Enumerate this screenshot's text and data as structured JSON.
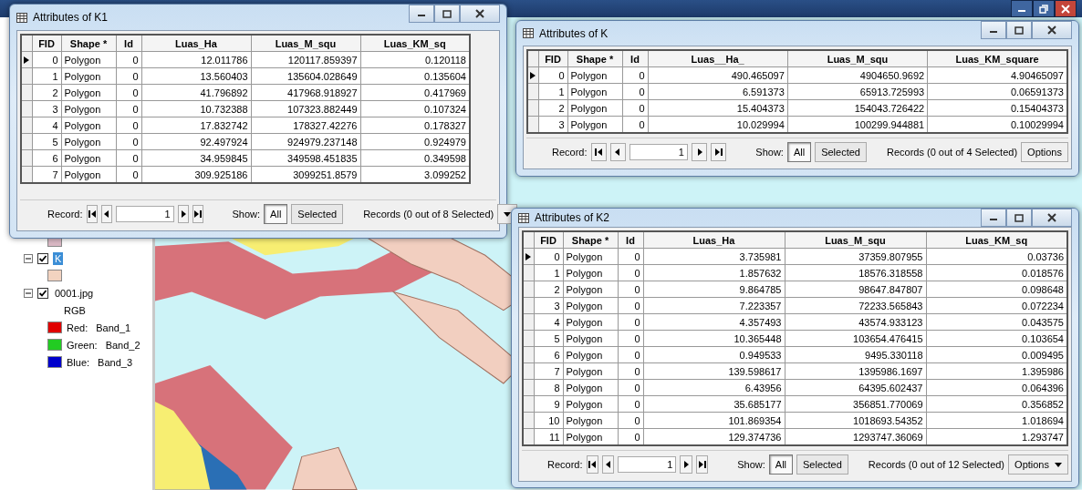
{
  "toc": {
    "items": [
      {
        "kind": "swatch",
        "color": "#d9b8c4"
      },
      {
        "kind": "layer",
        "label": "K",
        "checked": true,
        "expanded": true,
        "selected": true
      },
      {
        "kind": "swatch",
        "color": "#f2d3c0"
      },
      {
        "kind": "layer",
        "label": "0001.jpg",
        "checked": true,
        "expanded": true,
        "selected": false
      },
      {
        "kind": "heading",
        "label": "RGB"
      },
      {
        "kind": "band",
        "label": "Red:",
        "value": "Band_1",
        "color": "#e00000"
      },
      {
        "kind": "band",
        "label": "Green:",
        "value": "Band_2",
        "color": "#22cc22"
      },
      {
        "kind": "band",
        "label": "Blue:",
        "value": "Band_3",
        "color": "#0000cc"
      }
    ]
  },
  "windows": [
    {
      "title": "Attributes of K1",
      "columns": [
        "FID",
        "Shape *",
        "Id",
        "Luas_Ha",
        "Luas_M_squ",
        "Luas_KM_sq"
      ],
      "rows": [
        {
          "current": true,
          "cells": [
            "0",
            "Polygon",
            "0",
            "12.011786",
            "120117.859397",
            "0.120118"
          ]
        },
        {
          "current": false,
          "cells": [
            "1",
            "Polygon",
            "0",
            "13.560403",
            "135604.028649",
            "0.135604"
          ]
        },
        {
          "current": false,
          "cells": [
            "2",
            "Polygon",
            "0",
            "41.796892",
            "417968.918927",
            "0.417969"
          ]
        },
        {
          "current": false,
          "cells": [
            "3",
            "Polygon",
            "0",
            "10.732388",
            "107323.882449",
            "0.107324"
          ]
        },
        {
          "current": false,
          "cells": [
            "4",
            "Polygon",
            "0",
            "17.832742",
            "178327.42276",
            "0.178327"
          ]
        },
        {
          "current": false,
          "cells": [
            "5",
            "Polygon",
            "0",
            "92.497924",
            "924979.237148",
            "0.924979"
          ]
        },
        {
          "current": false,
          "cells": [
            "6",
            "Polygon",
            "0",
            "34.959845",
            "349598.451835",
            "0.349598"
          ]
        },
        {
          "current": false,
          "cells": [
            "7",
            "Polygon",
            "0",
            "309.925186",
            "3099251.8579",
            "3.099252"
          ]
        }
      ],
      "record_label": "Record:",
      "record_value": "1",
      "show_label": "Show:",
      "show": [
        {
          "label": "All",
          "selected": true
        },
        {
          "label": "Selected",
          "selected": false
        }
      ],
      "records": "Records (0 out of 8 Selected)",
      "options": {
        "caret": true
      }
    },
    {
      "title": "Attributes of K",
      "columns": [
        "FID",
        "Shape *",
        "Id",
        "Luas__Ha_",
        "Luas_M_squ",
        "Luas_KM_square"
      ],
      "rows": [
        {
          "current": true,
          "cells": [
            "0",
            "Polygon",
            "0",
            "490.465097",
            "4904650.9692",
            "4.90465097"
          ]
        },
        {
          "current": false,
          "cells": [
            "1",
            "Polygon",
            "0",
            "6.591373",
            "65913.725993",
            "0.06591373"
          ]
        },
        {
          "current": false,
          "cells": [
            "2",
            "Polygon",
            "0",
            "15.404373",
            "154043.726422",
            "0.15404373"
          ]
        },
        {
          "current": false,
          "cells": [
            "3",
            "Polygon",
            "0",
            "10.029994",
            "100299.944881",
            "0.10029994"
          ]
        }
      ],
      "record_label": "Record:",
      "record_value": "1",
      "show_label": "Show:",
      "show": [
        {
          "label": "All",
          "selected": true
        },
        {
          "label": "Selected",
          "selected": false
        }
      ],
      "records": "Records (0 out of 4 Selected)",
      "options": {
        "label": "Options",
        "caret": false
      }
    },
    {
      "title": "Attributes of K2",
      "columns": [
        "FID",
        "Shape *",
        "Id",
        "Luas_Ha",
        "Luas_M_squ",
        "Luas_KM_sq"
      ],
      "rows": [
        {
          "current": true,
          "cells": [
            "0",
            "Polygon",
            "0",
            "3.735981",
            "37359.807955",
            "0.03736"
          ]
        },
        {
          "current": false,
          "cells": [
            "1",
            "Polygon",
            "0",
            "1.857632",
            "18576.318558",
            "0.018576"
          ]
        },
        {
          "current": false,
          "cells": [
            "2",
            "Polygon",
            "0",
            "9.864785",
            "98647.847807",
            "0.098648"
          ]
        },
        {
          "current": false,
          "cells": [
            "3",
            "Polygon",
            "0",
            "7.223357",
            "72233.565843",
            "0.072234"
          ]
        },
        {
          "current": false,
          "cells": [
            "4",
            "Polygon",
            "0",
            "4.357493",
            "43574.933123",
            "0.043575"
          ]
        },
        {
          "current": false,
          "cells": [
            "5",
            "Polygon",
            "0",
            "10.365448",
            "103654.476415",
            "0.103654"
          ]
        },
        {
          "current": false,
          "cells": [
            "6",
            "Polygon",
            "0",
            "0.949533",
            "9495.330118",
            "0.009495"
          ]
        },
        {
          "current": false,
          "cells": [
            "7",
            "Polygon",
            "0",
            "139.598617",
            "1395986.1697",
            "1.395986"
          ]
        },
        {
          "current": false,
          "cells": [
            "8",
            "Polygon",
            "0",
            "6.43956",
            "64395.602437",
            "0.064396"
          ]
        },
        {
          "current": false,
          "cells": [
            "9",
            "Polygon",
            "0",
            "35.685177",
            "356851.770069",
            "0.356852"
          ]
        },
        {
          "current": false,
          "cells": [
            "10",
            "Polygon",
            "0",
            "101.869354",
            "1018693.54352",
            "1.018694"
          ]
        },
        {
          "current": false,
          "cells": [
            "11",
            "Polygon",
            "0",
            "129.374736",
            "1293747.36069",
            "1.293747"
          ]
        }
      ],
      "record_label": "Record:",
      "record_value": "1",
      "show_label": "Show:",
      "show": [
        {
          "label": "All",
          "selected": true
        },
        {
          "label": "Selected",
          "selected": false
        }
      ],
      "records": "Records (0 out of 12 Selected)",
      "options": {
        "label": "Options",
        "caret": true
      }
    }
  ]
}
